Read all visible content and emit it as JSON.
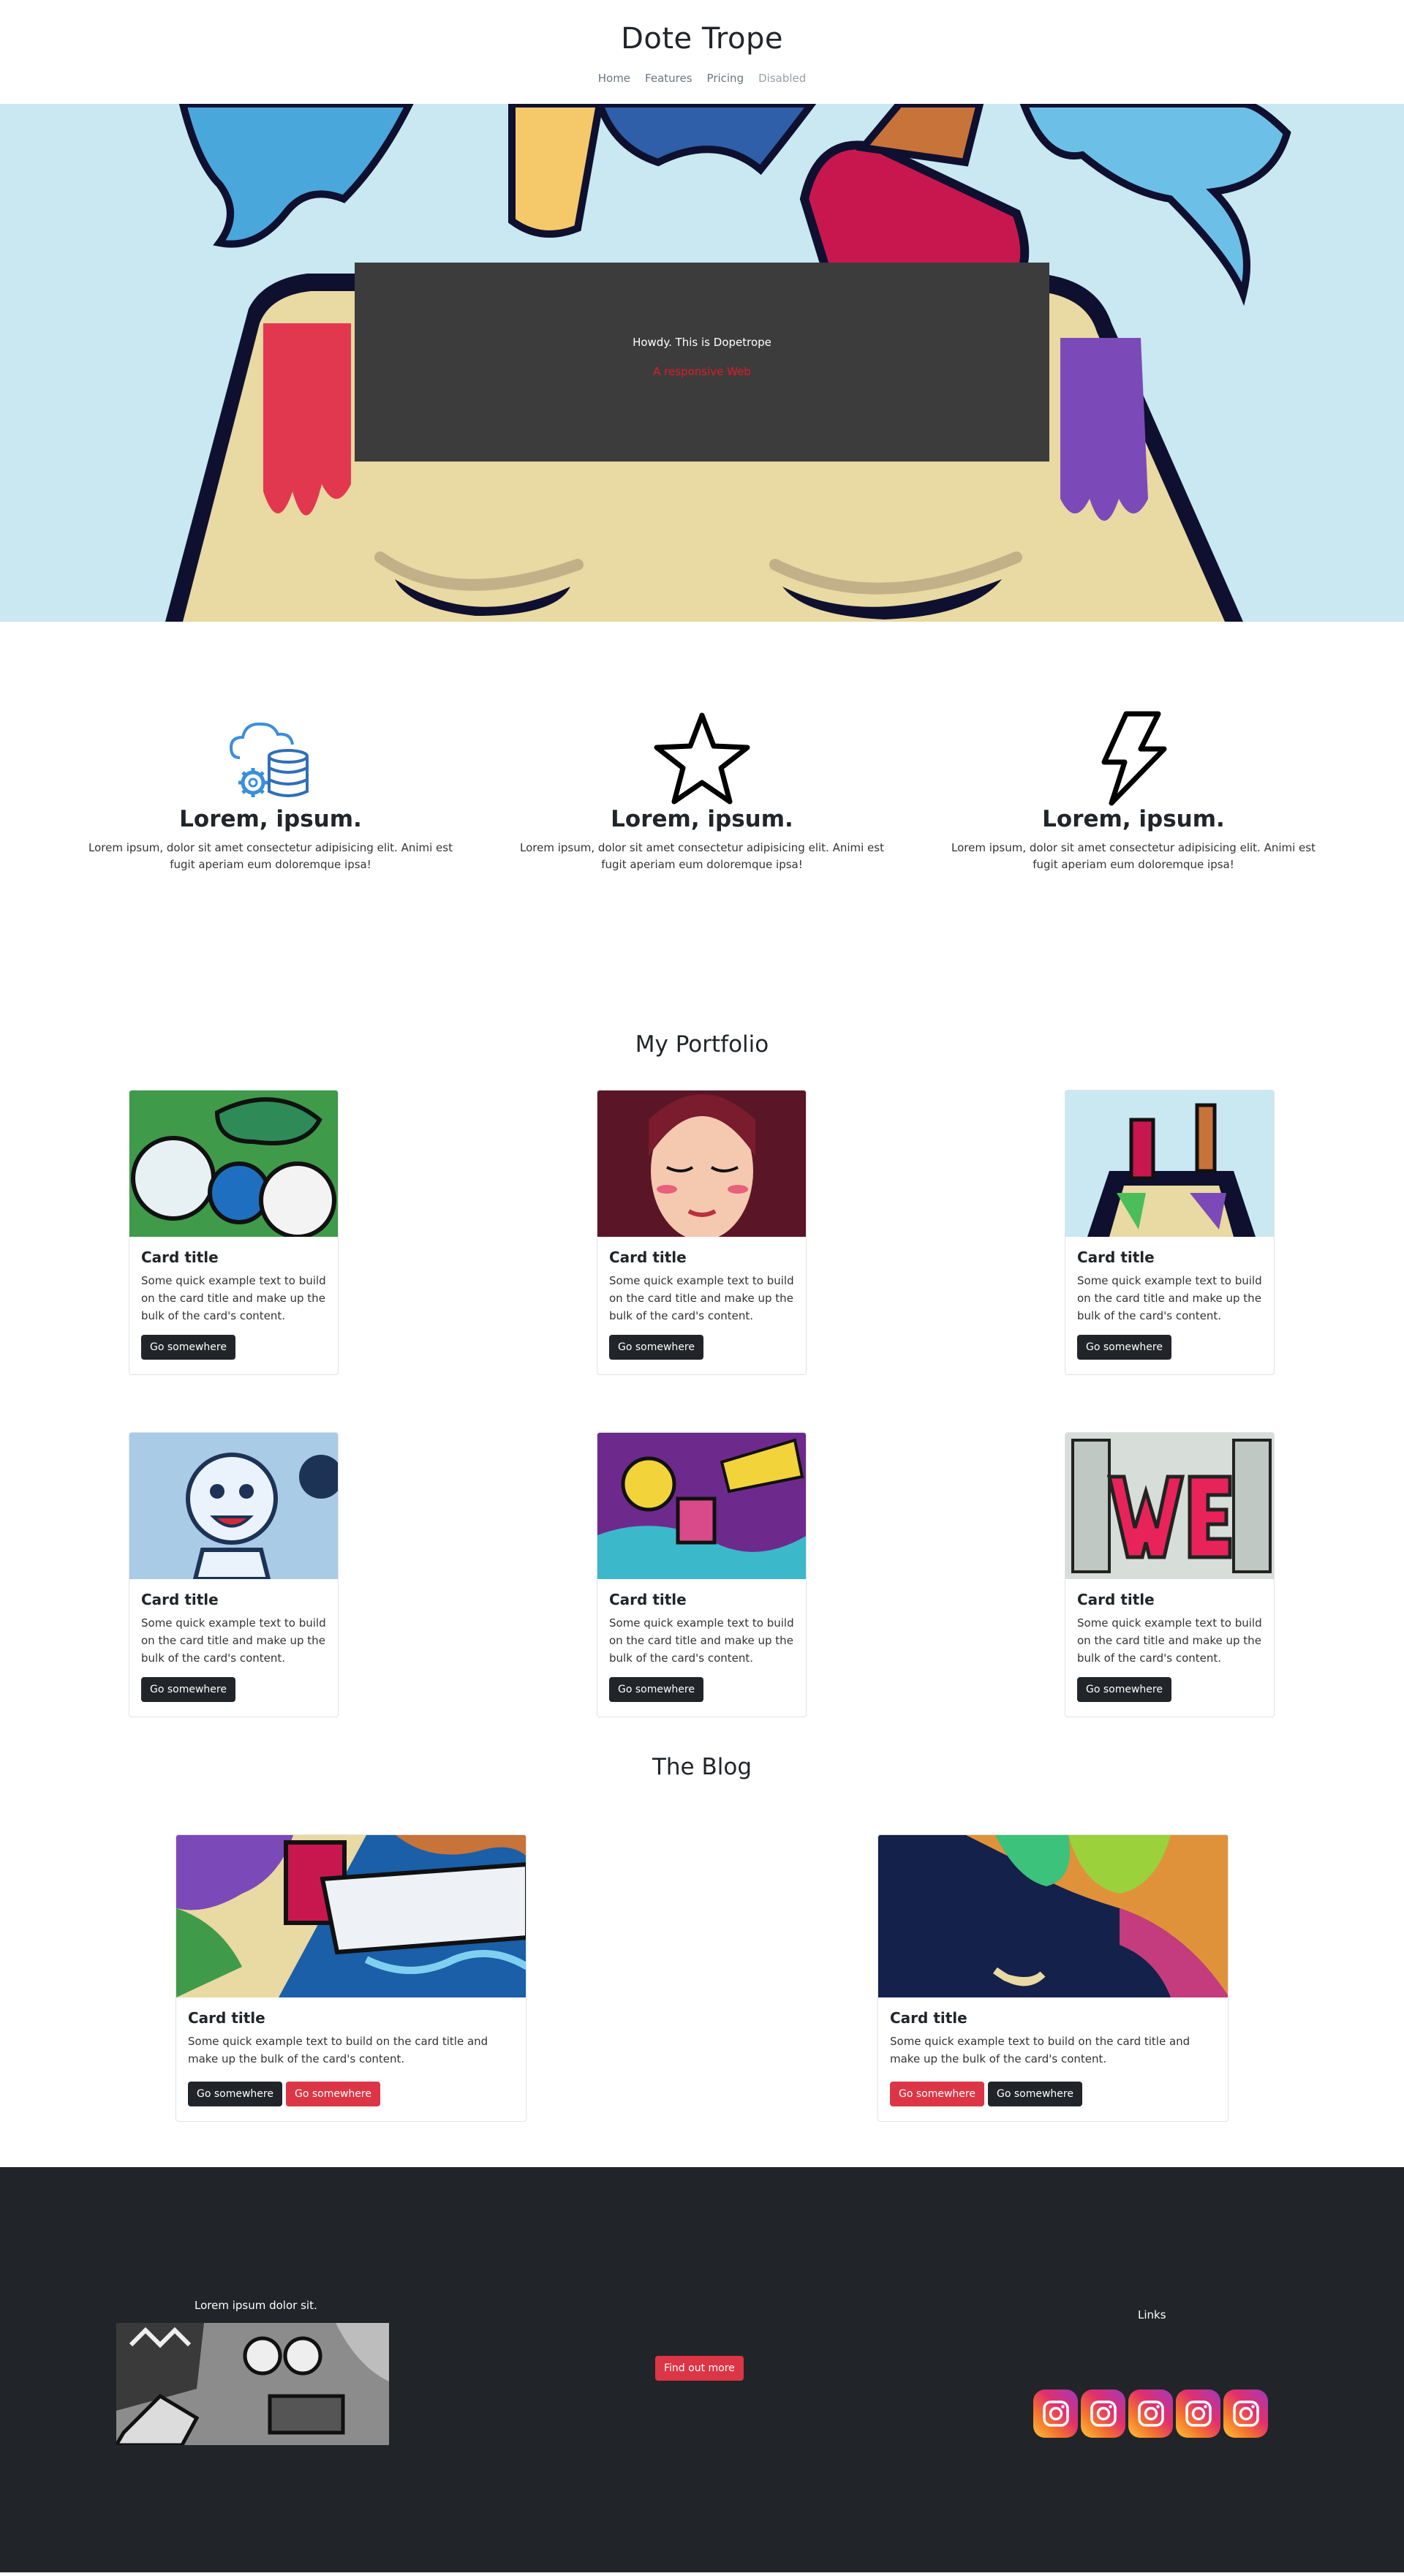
{
  "header": {
    "brand": "Dote Trope",
    "nav": [
      "Home",
      "Features",
      "Pricing",
      "Disabled"
    ]
  },
  "hero": {
    "title": "Howdy. This is Dopetrope",
    "subtitle": "A responsive Web"
  },
  "features": [
    {
      "icon": "cloud-database-icon",
      "title": "Lorem, ipsum.",
      "text": "Lorem ipsum, dolor sit amet consectetur adipisicing elit. Animi est fugit aperiam eum doloremque ipsa!"
    },
    {
      "icon": "star-icon",
      "title": "Lorem, ipsum.",
      "text": "Lorem ipsum, dolor sit amet consectetur adipisicing elit. Animi est fugit aperiam eum doloremque ipsa!"
    },
    {
      "icon": "lightning-icon",
      "title": "Lorem, ipsum.",
      "text": "Lorem ipsum, dolor sit amet consectetur adipisicing elit. Animi est fugit aperiam eum doloremque ipsa!"
    }
  ],
  "portfolio": {
    "title": "My Portfolio",
    "cards": [
      {
        "title": "Card title",
        "text": "Some quick example text to build on the card title and make up the bulk of the card's content.",
        "button": "Go somewhere"
      },
      {
        "title": "Card title",
        "text": "Some quick example text to build on the card title and make up the bulk of the card's content.",
        "button": "Go somewhere"
      },
      {
        "title": "Card title",
        "text": "Some quick example text to build on the card title and make up the bulk of the card's content.",
        "button": "Go somewhere"
      },
      {
        "title": "Card title",
        "text": "Some quick example text to build on the card title and make up the bulk of the card's content.",
        "button": "Go somewhere"
      },
      {
        "title": "Card title",
        "text": "Some quick example text to build on the card title and make up the bulk of the card's content.",
        "button": "Go somewhere"
      },
      {
        "title": "Card title",
        "text": "Some quick example text to build on the card title and make up the bulk of the card's content.",
        "button": "Go somewhere"
      }
    ]
  },
  "blog": {
    "title": "The Blog",
    "cards": [
      {
        "title": "Card title",
        "text": "Some quick example text to build on the card title and make up the bulk of the card's content.",
        "buttons": [
          "Go somewhere",
          "Go somewhere"
        ]
      },
      {
        "title": "Card title",
        "text": "Some quick example text to build on the card title and make up the bulk of the card's content.",
        "buttons": [
          "Go somewhere",
          "Go somewhere"
        ]
      }
    ]
  },
  "footer": {
    "caption": "Lorem ipsum dolor sit.",
    "cta": "Find out more",
    "links_label": "Links",
    "socials": [
      "instagram-icon",
      "instagram-icon",
      "instagram-icon",
      "instagram-icon",
      "instagram-icon"
    ]
  },
  "colors": {
    "hero_bg": "#c9e8f2",
    "hero_box": "#3d3c3d",
    "accent_red": "#dc3545",
    "dark": "#212529"
  }
}
